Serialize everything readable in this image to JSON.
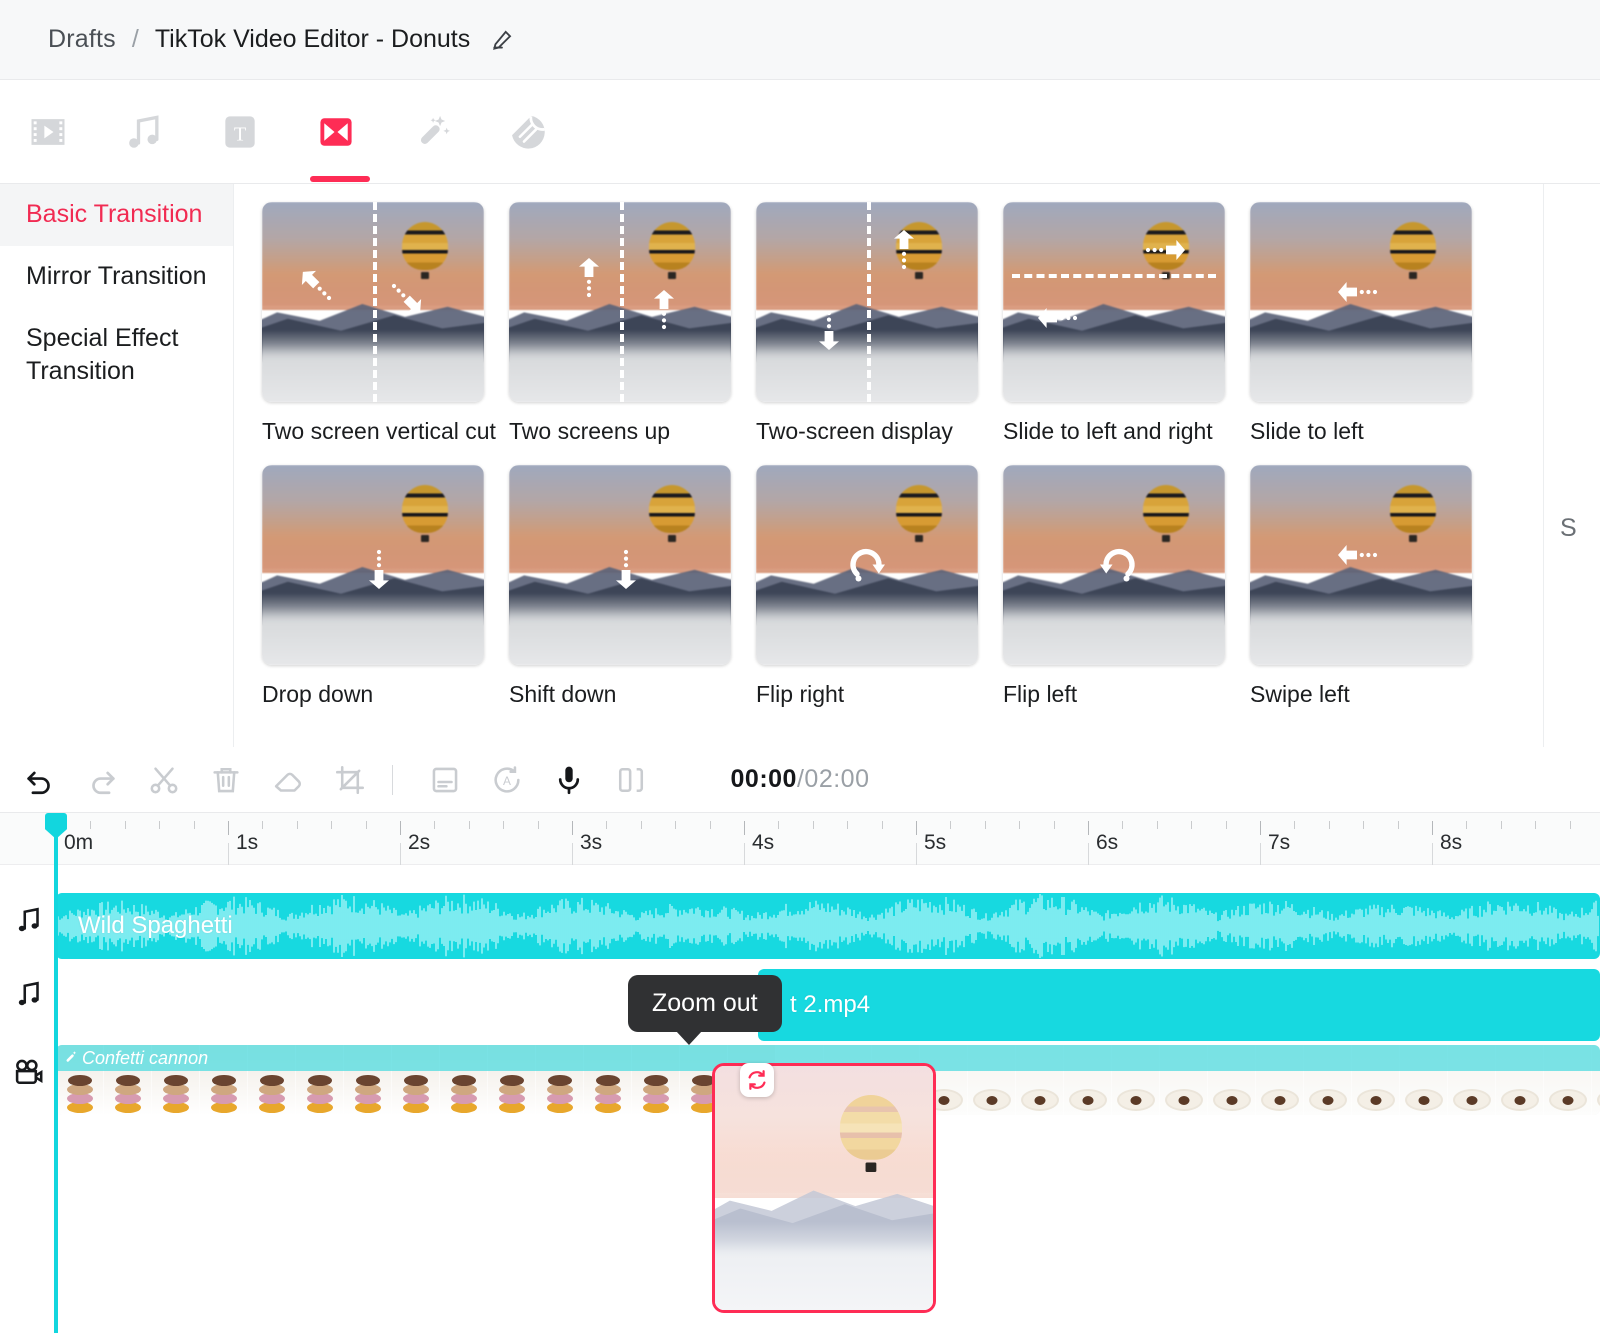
{
  "header": {
    "breadcrumb_root": "Drafts",
    "separator": "/",
    "project_title": "TikTok Video Editor - Donuts",
    "edit_icon": "pencil-icon"
  },
  "tabs": [
    {
      "name": "media",
      "icon": "film-icon",
      "active": false
    },
    {
      "name": "audio",
      "icon": "music-note-icon",
      "active": false
    },
    {
      "name": "text",
      "icon": "text-t-icon",
      "active": false
    },
    {
      "name": "transition",
      "icon": "transition-bowtie-icon",
      "active": true
    },
    {
      "name": "effects",
      "icon": "magic-wand-icon",
      "active": false
    },
    {
      "name": "stickers",
      "icon": "sticker-icon",
      "active": false
    }
  ],
  "sidebar": {
    "items": [
      {
        "label": "Basic Transition",
        "active": true
      },
      {
        "label": "Mirror Transition",
        "active": false
      },
      {
        "label": "Special Effect Transition",
        "active": false
      }
    ]
  },
  "transitions": [
    {
      "label": "Two screen vertical cut",
      "arrows": "up-left-and-down-right",
      "guide": "vertical"
    },
    {
      "label": "Two screens up",
      "arrows": "two-up",
      "guide": "vertical"
    },
    {
      "label": "Two-screen display",
      "arrows": "up-and-down",
      "guide": "vertical"
    },
    {
      "label": "Slide to left and right",
      "arrows": "right-and-left",
      "guide": "horizontal"
    },
    {
      "label": "Slide to left",
      "arrows": "left",
      "guide": "none"
    },
    {
      "label": "Drop down",
      "arrows": "down",
      "guide": "none"
    },
    {
      "label": "Shift down",
      "arrows": "down",
      "guide": "none"
    },
    {
      "label": "Flip right",
      "arrows": "rotate-right",
      "guide": "none"
    },
    {
      "label": "Flip left",
      "arrows": "rotate-left",
      "guide": "none"
    },
    {
      "label": "Swipe left",
      "arrows": "left",
      "guide": "none"
    }
  ],
  "panel_cut_text": "S",
  "toolbar": {
    "buttons": [
      {
        "name": "undo",
        "icon": "undo-arrow-icon",
        "enabled": true
      },
      {
        "name": "redo",
        "icon": "redo-arrow-icon",
        "enabled": false
      },
      {
        "name": "split",
        "icon": "scissors-icon",
        "enabled": false
      },
      {
        "name": "delete",
        "icon": "trash-icon",
        "enabled": false
      },
      {
        "name": "erase",
        "icon": "eraser-icon",
        "enabled": false
      },
      {
        "name": "crop",
        "icon": "crop-icon",
        "enabled": false
      },
      {
        "name": "caption",
        "icon": "caption-icon",
        "enabled": false
      },
      {
        "name": "auto-caption",
        "icon": "auto-caption-icon",
        "enabled": false
      },
      {
        "name": "voiceover",
        "icon": "microphone-icon",
        "enabled": true
      },
      {
        "name": "mirror",
        "icon": "mirror-flip-icon",
        "enabled": false
      }
    ],
    "time_current": "00:00",
    "time_separator": "/",
    "time_total": "02:00"
  },
  "timeline": {
    "ruler_labels": [
      "0m",
      "1s",
      "2s",
      "3s",
      "4s",
      "5s",
      "6s",
      "7s",
      "8s"
    ],
    "playhead_position": "0m",
    "tracks": [
      {
        "icon": "music-note-icon",
        "clip_name": "Wild Spaghetti",
        "type": "audio"
      },
      {
        "icon": "music-note-icon",
        "clip_name": "t 2.mp4",
        "type": "audio"
      },
      {
        "icon": "video-camera-icon",
        "clip_name": "",
        "type": "video",
        "effect_label": "Confetti cannon",
        "effect_icon": "magic-wand-icon"
      }
    ],
    "transition_marker_icon": "transition-loop-icon"
  },
  "tooltip": {
    "text": "Zoom out"
  },
  "colors": {
    "accent_red": "#fe2c55",
    "accent_cyan": "#17d9e0",
    "sidebar_active_text": "#f12b52",
    "tooltip_bg": "#303133"
  }
}
